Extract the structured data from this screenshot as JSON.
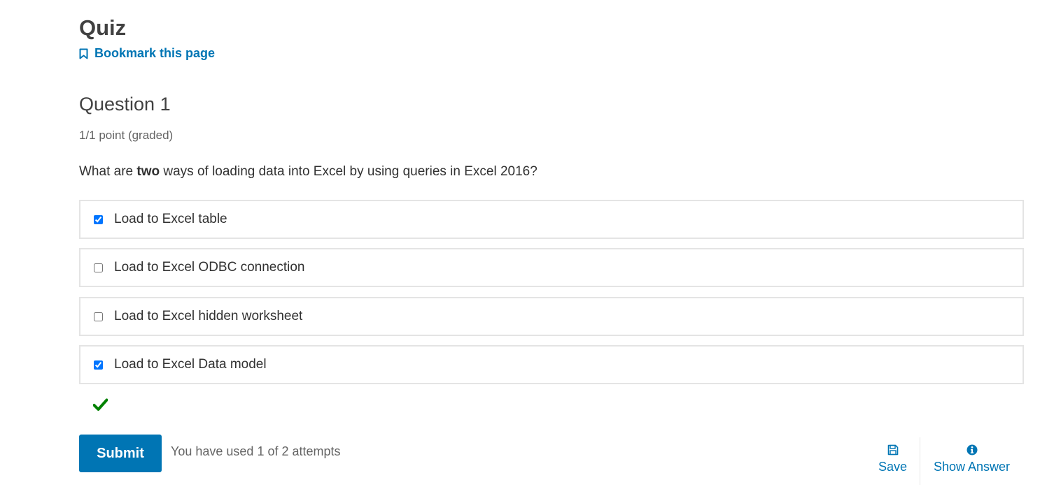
{
  "page": {
    "title": "Quiz",
    "bookmark_label": "Bookmark this page"
  },
  "problem": {
    "title": "Question 1",
    "points": "1/1 point (graded)",
    "prompt_before": "What are ",
    "prompt_bold": "two",
    "prompt_after": " ways of loading data into Excel by using queries in Excel 2016?",
    "choices": [
      {
        "label": "Load to Excel table",
        "checked": true
      },
      {
        "label": "Load to Excel ODBC connection",
        "checked": false
      },
      {
        "label": "Load to Excel hidden worksheet",
        "checked": false
      },
      {
        "label": "Load to Excel Data model",
        "checked": true
      }
    ],
    "status_icon": "checkmark-icon",
    "status": "correct"
  },
  "actions": {
    "submit_label": "Submit",
    "attempts_text": "You have used 1 of 2 attempts",
    "save_label": "Save",
    "show_answer_label": "Show Answer"
  },
  "colors": {
    "link": "#0075b4",
    "correct": "#008100",
    "border": "#e4e4e4"
  }
}
